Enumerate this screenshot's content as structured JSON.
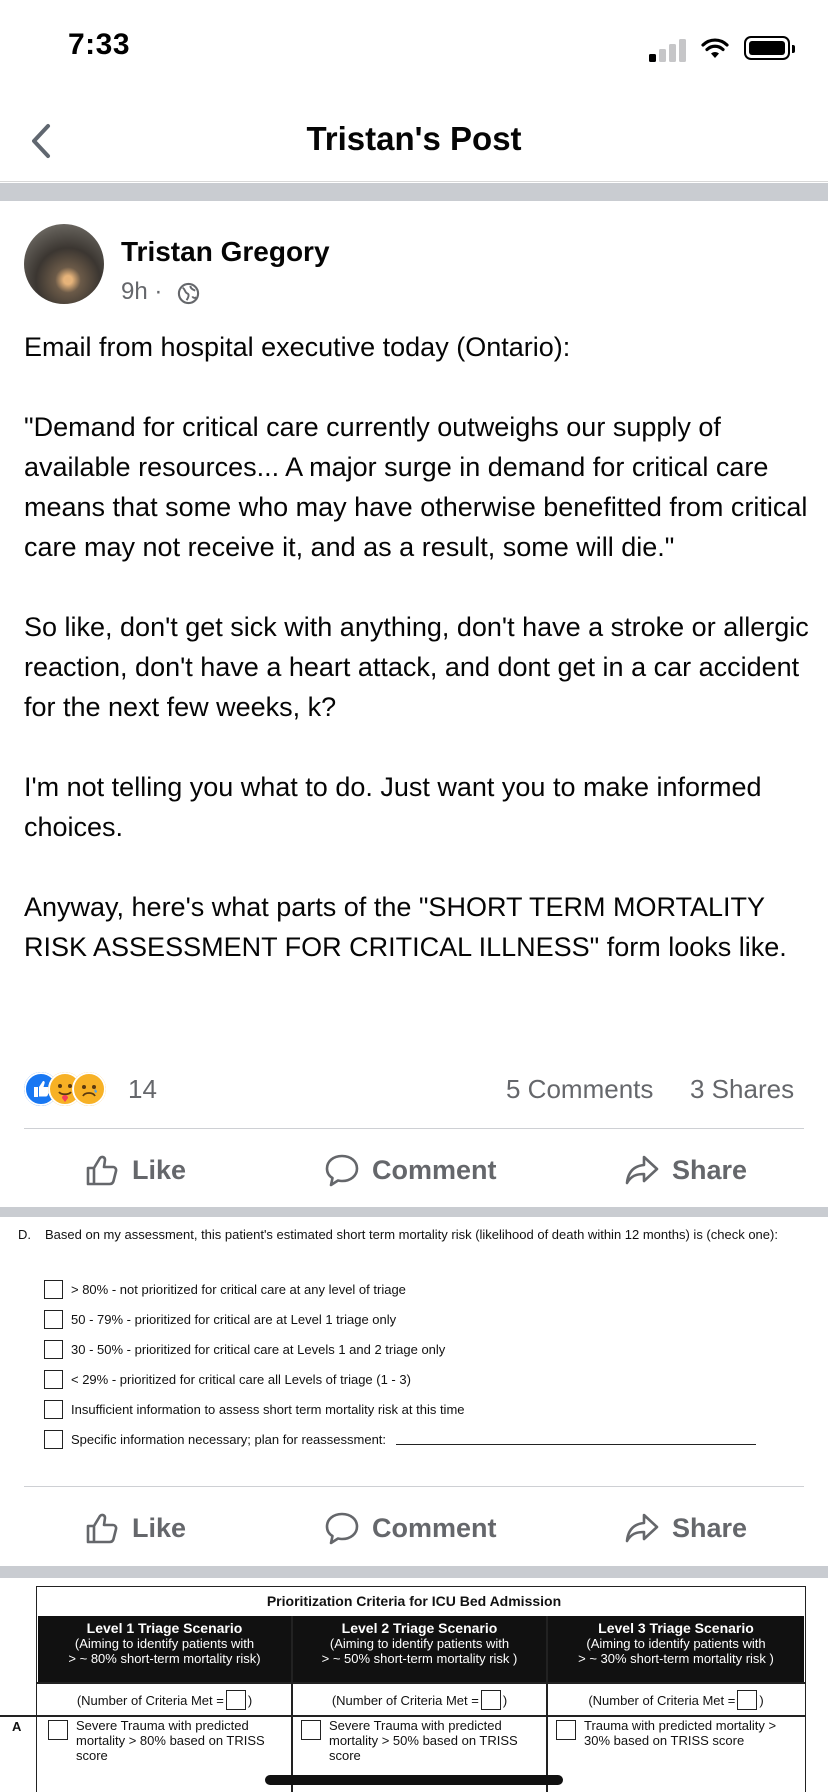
{
  "status_bar": {
    "time": "7:33",
    "signal_bars_active": 1,
    "signal_bars_total": 4
  },
  "nav": {
    "title": "Tristan's Post",
    "back_icon": "chevron-left-icon"
  },
  "post": {
    "author": "Tristan Gregory",
    "time": "9h ·",
    "privacy_icon": "globe-icon",
    "paragraphs": [
      "Email from hospital executive today (Ontario):",
      "\"Demand for critical care currently outweighs our supply of available resources... A major surge in demand for critical care means that some who may have otherwise benefitted from critical care may not receive it, and as a result, some will die.\"",
      "So like, don't get sick with anything, don't have a stroke or allergic reaction, don't have a heart attack, and dont get in a car accident for the next few weeks, k?",
      "I'm not telling you what to do. Just want you to make informed choices.",
      "Anyway, here's what parts of the \"SHORT TERM MORTALITY RISK ASSESSMENT FOR CRITICAL ILLNESS\" form looks like."
    ],
    "reaction_count": "14",
    "reaction_icons": [
      "like-icon",
      "care-icon",
      "sad-icon"
    ],
    "comments": "5 Comments",
    "shares": "3 Shares"
  },
  "actions": {
    "like": "Like",
    "comment": "Comment",
    "share": "Share"
  },
  "form_image_1": {
    "label": "D.",
    "question": "Based on my assessment, this patient's estimated short term mortality risk (likelihood of death within 12 months) is (check one):",
    "options": [
      "> 80% - not prioritized  for critical care at any level of triage",
      "50 - 79% - prioritized  for critical are at Level 1 triage only",
      "30 - 50% - prioritized  for critical care at  Levels 1 and 2 triage only",
      "< 29% - prioritized  for critical care all Levels of triage (1 - 3)",
      "Insufficient information to assess short term mortality risk at this time",
      "Specific information necessary; plan for reassessment:"
    ]
  },
  "form_image_2": {
    "title": "Prioritization Criteria for ICU Bed Admission",
    "levels": [
      {
        "name": "Level 1 Triage Scenario",
        "line1": "(Aiming to identify patients with",
        "line2": "> ~ 80%  short-term mortality risk)",
        "count": "(Number of Criteria Met =",
        "close": ")",
        "cell": "Severe Trauma with predicted mortality > 80% based on TRISS score"
      },
      {
        "name": "Level 2 Triage Scenario",
        "line1": "(Aiming to identify patients with",
        "line2": "> ~ 50%  short-term mortality risk )",
        "count": "(Number of Criteria Met =",
        "close": ")",
        "cell": "Severe Trauma with predicted mortality > 50% based on TRISS score"
      },
      {
        "name": "Level 3 Triage Scenario",
        "line1": "(Aiming to identify patients with",
        "line2": "> ~ 30%  short-term mortality risk )",
        "count": "(Number of Criteria Met =",
        "close": ")",
        "cell": "Trauma with predicted mortality > 30% based on TRISS score"
      }
    ],
    "row_label": "A"
  }
}
